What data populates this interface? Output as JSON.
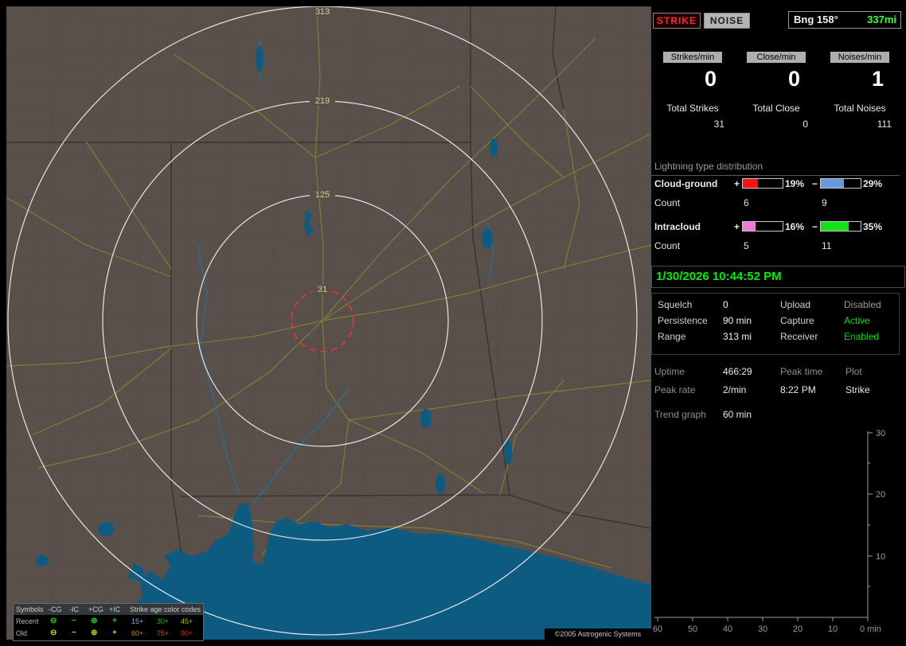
{
  "top": {
    "strike": "STRIKE",
    "noise": "NOISE",
    "bearing": "Bng 158°",
    "distance": "337mi",
    "distance_color": "#3cff3c"
  },
  "counters": {
    "columns": [
      {
        "header": "Strikes/min",
        "rate": "0",
        "total_label": "Total Strikes",
        "total": "31"
      },
      {
        "header": "Close/min",
        "rate": "0",
        "total_label": "Total Close",
        "total": "0"
      },
      {
        "header": "Noises/min",
        "rate": "1",
        "total_label": "Total Noises",
        "total": "111"
      }
    ]
  },
  "distribution": {
    "title": "Lightning type distribution",
    "rows": [
      {
        "label": "Cloud-ground",
        "plus_sign": "+",
        "plus_pct": "19%",
        "plus_fill": 38,
        "plus_color": "#ff1010",
        "minus_sign": "−",
        "minus_pct": "29%",
        "minus_fill": 58,
        "minus_color": "#6699e0",
        "count_label": "Count",
        "plus_count": "6",
        "minus_count": "9"
      },
      {
        "label": "Intracloud",
        "plus_sign": "+",
        "plus_pct": "16%",
        "plus_fill": 32,
        "plus_color": "#f078d8",
        "minus_sign": "−",
        "minus_pct": "35%",
        "minus_fill": 70,
        "minus_color": "#15e015",
        "count_label": "Count",
        "plus_count": "5",
        "minus_count": "11"
      }
    ]
  },
  "datetime": {
    "value": "1/30/2026 10:44:52 PM",
    "color": "#00ee00"
  },
  "settings": [
    {
      "l1": "Squelch",
      "v1": "0",
      "l2": "Upload",
      "v2": "Disabled",
      "v2_color": "#9a9a9a"
    },
    {
      "l1": "Persistence",
      "v1": "90 min",
      "l2": "Capture",
      "v2": "Active",
      "v2_color": "#00dd00"
    },
    {
      "l1": "Range",
      "v1": "313 mi",
      "l2": "Receiver",
      "v2": "Enabled",
      "v2_color": "#00dd00"
    }
  ],
  "stats": {
    "uptime_label": "Uptime",
    "uptime": "466:29",
    "peak_rate_label": "Peak rate",
    "peak_rate": "2/min",
    "peak_time_label": "Peak time",
    "peak_time": "8:22 PM",
    "plot_label": "Plot",
    "plot": "Strike",
    "trend_label": "Trend graph",
    "trend_value": "60 min"
  },
  "trend_axes": {
    "type": "line",
    "y_ticks": [
      "30",
      "20",
      "10"
    ],
    "x_ticks": [
      "60",
      "50",
      "40",
      "30",
      "20",
      "10"
    ],
    "x_end": "0 min",
    "series": []
  },
  "map": {
    "ring_labels": [
      "313",
      "219",
      "125",
      "31"
    ],
    "ring_label_color": "#d6d284",
    "alarm_ring_color": "#ff3333",
    "copyright": "©2005 Astrogenic Systems"
  },
  "legend": {
    "symbols_header": "Symbols",
    "columns": [
      "-CG",
      "-IC",
      "+CG",
      "+IC"
    ],
    "age_header": "Strike age color codes",
    "recent_label": "Recent",
    "old_label": "Old",
    "recent_symbols": [
      "⊖",
      "−",
      "⊕",
      "+"
    ],
    "old_symbols": [
      "⊖",
      "−",
      "⊕",
      "+"
    ],
    "recent_color": "#22cc22",
    "old_color": "#cccc22",
    "recent_ages": [
      {
        "t": "15+",
        "c": "#8fa8ff"
      },
      {
        "t": "30+",
        "c": "#22bb22"
      },
      {
        "t": "45+",
        "c": "#bbbb22"
      }
    ],
    "old_ages": [
      {
        "t": "60+",
        "c": "#bb8822"
      },
      {
        "t": "75+",
        "c": "#cc5511"
      },
      {
        "t": "90+",
        "c": "#dd2211"
      }
    ]
  }
}
